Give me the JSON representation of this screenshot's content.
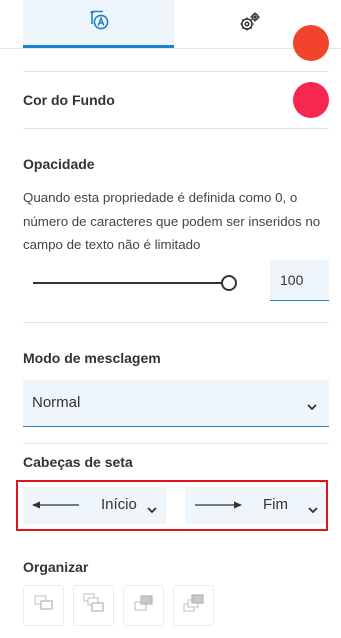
{
  "tabs": [
    {
      "name": "style",
      "icon": "style-text-icon",
      "active": true
    },
    {
      "name": "settings",
      "icon": "gears-icon",
      "active": false
    }
  ],
  "colors": {
    "accent": "#1b84c9",
    "highlight_border": "#e0141b",
    "prev_color": "#f2432c",
    "background_color": "#f7284f"
  },
  "background": {
    "label": "Cor do Fundo",
    "color": "#f7284f"
  },
  "opacity": {
    "label": "Opacidade",
    "description": "Quando esta propriedade é definida como 0, o número de caracteres que podem ser inseridos no campo de texto não é limitado",
    "value": "100",
    "slider_fraction": 1.0
  },
  "blend": {
    "label": "Modo de mesclagem",
    "value": "Normal"
  },
  "arrowheads": {
    "label": "Cabeças de seta",
    "start": "Início",
    "end": "Fim"
  },
  "arrange": {
    "label": "Organizar",
    "buttons": [
      "bring-to-front-icon",
      "bring-forward-icon",
      "send-backward-icon",
      "send-to-back-icon"
    ]
  }
}
